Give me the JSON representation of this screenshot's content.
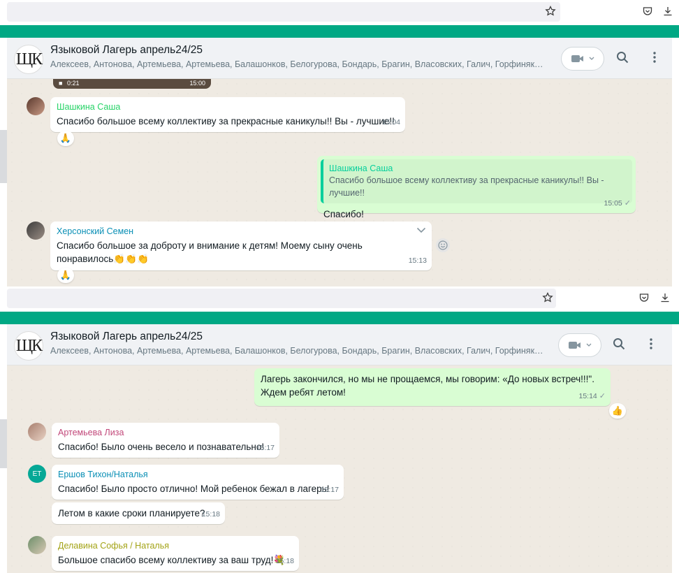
{
  "colors": {
    "accent": "#00a884",
    "incoming_bubble": "#ffffff",
    "outgoing_bubble": "#d9fdd3",
    "chat_background": "#efeae2"
  },
  "browser": {
    "icons": [
      "star-icon",
      "pocket-icon",
      "download-icon"
    ]
  },
  "chat": {
    "avatar_text": "ЩК",
    "title": "Языковой Лагерь апрель24/25",
    "members": "Алексеев, Антонова, Артемьева, Артемьева, Балашонков, Белогурова, Бондарь, Брагин, Власовских, Галич, Горфиняк, Горшков..."
  },
  "top_panel": {
    "video_thumb": {
      "left_time": "0:21",
      "right_time": "15:00"
    },
    "messages": [
      {
        "sender": "Шашкина Саша",
        "sender_color": "#25d366",
        "text": "Спасибо большое всему коллективу за прекрасные каникулы!! Вы - лучшие!!",
        "time": "15:04",
        "reaction": "🙏"
      },
      {
        "quote_sender": "Шашкина Саша",
        "quote_text": "Спасибо большое всему коллективу за прекрасные каникулы!! Вы - лучшие!!",
        "text": "Спасибо!",
        "time": "15:05"
      },
      {
        "sender": "Херсонский Семен",
        "sender_color": "#0a8fb5",
        "text": "Спасибо большое за доброту и внимание к детям! Моему сыну очень понравилось👏👏👏",
        "time": "15:13",
        "reaction": "🙏"
      }
    ]
  },
  "bottom_panel": {
    "messages": [
      {
        "text": "Лагерь закончился, но мы не прощаемся, мы говорим: «До новых встреч!!!\". Ждем ребят летом!",
        "time": "15:14",
        "reaction": "👍"
      },
      {
        "sender": "Артемьева Лиза",
        "sender_color": "#c2487a",
        "text": "Спасибо! Было очень весело и познавательно!",
        "time": "15:17"
      },
      {
        "avatar_initials": "ЕТ",
        "sender": "Ершов Тихон/Наталья",
        "sender_color": "#0a8fb5",
        "text": "Спасибо! Было просто отлично! Мой ребенок бежал в лагерь!",
        "time": "15:17"
      },
      {
        "text": "Летом в какие сроки планируете?",
        "time": "15:18"
      },
      {
        "sender": "Делавина Софья / Наталья",
        "sender_color": "#a3a316",
        "text": "Большое спасибо всему коллективу за ваш труд!💐",
        "time": "15:18"
      }
    ]
  }
}
